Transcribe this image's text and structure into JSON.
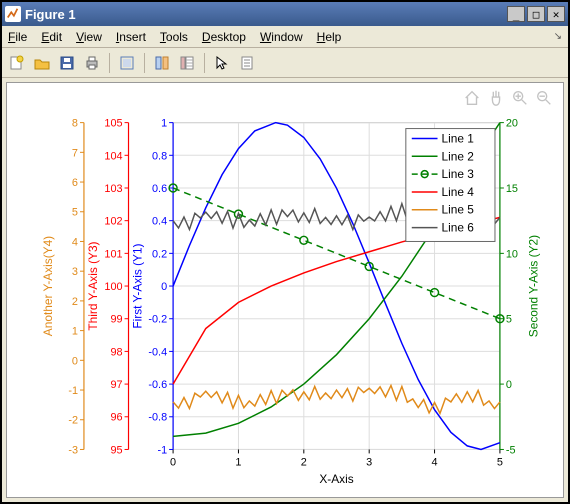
{
  "window": {
    "title": "Figure 1"
  },
  "menu": {
    "file": "File",
    "edit": "Edit",
    "view": "View",
    "insert": "Insert",
    "tools": "Tools",
    "desktop": "Desktop",
    "window": "Window",
    "help": "Help"
  },
  "legend": {
    "items": [
      "Line 1",
      "Line 2",
      "Line 3",
      "Line 4",
      "Line 5",
      "Line 6"
    ]
  },
  "axes": {
    "xlabel": "X-Axis",
    "y1": {
      "label": "First Y-Axis (Y1)",
      "color": "#0000ff"
    },
    "y2": {
      "label": "Second Y-Axis (Y2)",
      "color": "#008000"
    },
    "y3": {
      "label": "Third Y-Axis (Y3)",
      "color": "#ff0000"
    },
    "y4": {
      "label": "Another Y-Axis(Y4)",
      "color": "#e08a1a"
    }
  },
  "chart_data": {
    "type": "line",
    "xlabel": "X-Axis",
    "xlim": [
      0,
      5
    ],
    "xticks": [
      0,
      1,
      2,
      3,
      4,
      5
    ],
    "axes": [
      {
        "id": "y1",
        "label": "First Y-Axis (Y1)",
        "side": "left",
        "color": "#0000ff",
        "ylim": [
          -1,
          1
        ],
        "ticks": [
          -1,
          -0.8,
          -0.6,
          -0.4,
          -0.2,
          0,
          0.2,
          0.4,
          0.6,
          0.8,
          1
        ]
      },
      {
        "id": "y2",
        "label": "Second Y-Axis (Y2)",
        "side": "right",
        "color": "#008000",
        "ylim": [
          -5,
          20
        ],
        "ticks": [
          -5,
          0,
          5,
          10,
          15,
          20
        ]
      },
      {
        "id": "y3",
        "label": "Third Y-Axis (Y3)",
        "side": "left",
        "color": "#ff0000",
        "ylim": [
          95,
          105
        ],
        "ticks": [
          95,
          96,
          97,
          98,
          99,
          100,
          101,
          102,
          103,
          104,
          105
        ]
      },
      {
        "id": "y4",
        "label": "Another Y-Axis(Y4)",
        "side": "left",
        "color": "#e08a1a",
        "ylim": [
          -3,
          8
        ],
        "ticks": [
          -3,
          -2,
          -1,
          0,
          1,
          2,
          3,
          4,
          5,
          6,
          7,
          8
        ]
      }
    ],
    "series": [
      {
        "name": "Line 1",
        "axis": "y1",
        "color": "#0000ff",
        "style": "solid",
        "x": [
          0,
          0.25,
          0.5,
          0.75,
          1,
          1.25,
          1.57,
          1.75,
          2,
          2.25,
          2.5,
          2.75,
          3,
          3.25,
          3.5,
          3.75,
          4,
          4.25,
          4.5,
          4.71,
          5
        ],
        "y": [
          0,
          0.247,
          0.479,
          0.682,
          0.841,
          0.949,
          1.0,
          0.984,
          0.909,
          0.778,
          0.599,
          0.382,
          0.141,
          -0.108,
          -0.351,
          -0.572,
          -0.757,
          -0.895,
          -0.978,
          -1.0,
          -0.959
        ]
      },
      {
        "name": "Line 2",
        "axis": "y2",
        "color": "#008000",
        "style": "solid",
        "x": [
          0,
          0.5,
          1,
          1.5,
          2,
          2.5,
          3,
          3.5,
          4,
          4.5,
          5
        ],
        "y": [
          -4,
          -3.75,
          -3,
          -1.75,
          0,
          2.25,
          5,
          8.25,
          12,
          16.25,
          20
        ]
      },
      {
        "name": "Line 3",
        "axis": "y2",
        "color": "#008000",
        "style": "dashed",
        "markers": true,
        "x": [
          0,
          1,
          2,
          3,
          4,
          5
        ],
        "y": [
          15,
          13,
          11,
          9,
          7,
          5
        ]
      },
      {
        "name": "Line 4",
        "axis": "y3",
        "color": "#ff0000",
        "style": "solid",
        "x": [
          0,
          0.5,
          1,
          1.5,
          2,
          2.5,
          3,
          3.5,
          4,
          4.5,
          5
        ],
        "y": [
          97,
          98.7,
          99.5,
          100,
          100.4,
          100.75,
          101.05,
          101.35,
          101.6,
          101.85,
          102.1
        ]
      },
      {
        "name": "Line 5",
        "axis": "y4",
        "color": "#e08a1a",
        "style": "solid",
        "jagged": true,
        "x": [
          0,
          0.5,
          1,
          1.5,
          2,
          2.5,
          3,
          3.5,
          4,
          4.5,
          5
        ],
        "y": [
          -1.4,
          -1.2,
          -1.5,
          -1.1,
          -1.3,
          -1.0,
          -1.1,
          -1.2,
          -1.5,
          -1.3,
          -1.4
        ]
      },
      {
        "name": "Line 6",
        "axis": "y1",
        "color": "#555555",
        "style": "solid",
        "jagged": true,
        "x": [
          0,
          0.5,
          1,
          1.5,
          2,
          2.5,
          3,
          3.5,
          4,
          4.5,
          5
        ],
        "y": [
          0.4,
          0.42,
          0.38,
          0.45,
          0.4,
          0.43,
          0.39,
          0.44,
          0.4,
          0.46,
          0.42
        ]
      }
    ],
    "legend_position": "upper-right"
  }
}
